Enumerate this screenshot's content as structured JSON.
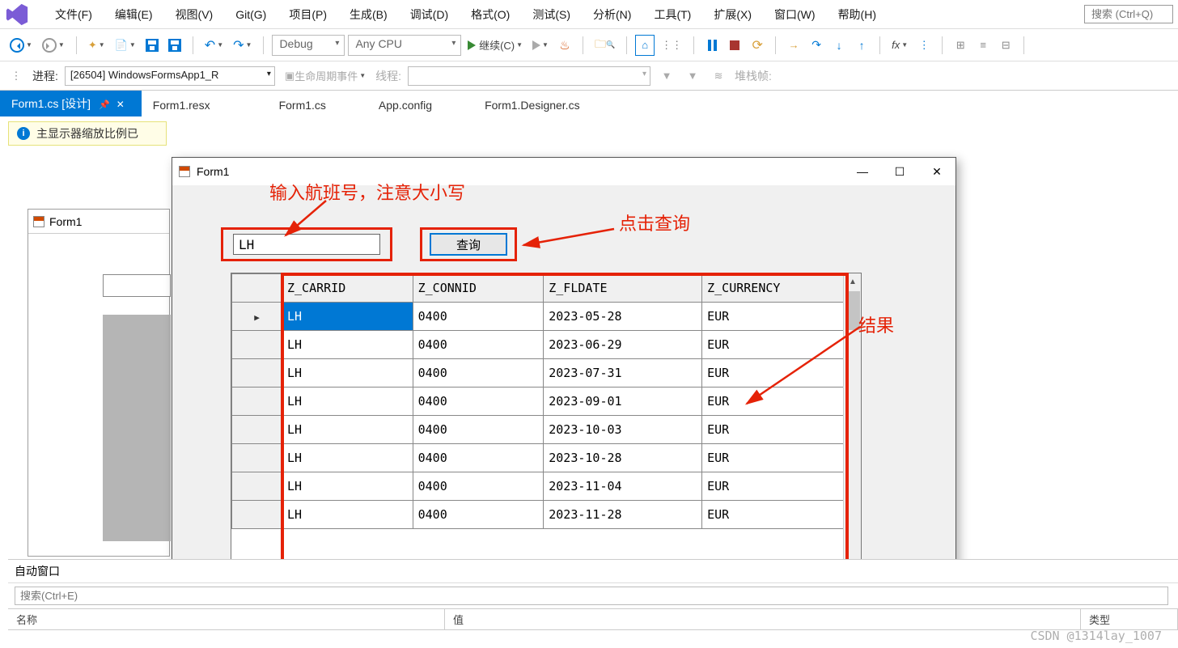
{
  "menu": {
    "items": [
      "文件(F)",
      "编辑(E)",
      "视图(V)",
      "Git(G)",
      "项目(P)",
      "生成(B)",
      "调试(D)",
      "格式(O)",
      "测试(S)",
      "分析(N)",
      "工具(T)",
      "扩展(X)",
      "窗口(W)",
      "帮助(H)"
    ],
    "search_placeholder": "搜索 (Ctrl+Q)"
  },
  "toolbar": {
    "config": "Debug",
    "platform": "Any CPU",
    "continue": "继续(C)"
  },
  "toolbar2": {
    "process_label": "进程:",
    "process_value": "[26504] WindowsFormsApp1_R",
    "lifecycle": "生命周期事件",
    "thread_label": "线程:",
    "stackframe": "堆栈帧:"
  },
  "tabs": [
    "Form1.cs [设计]",
    "Form1.resx",
    "Form1.cs",
    "App.config",
    "Form1.Designer.cs"
  ],
  "info_bar": "主显示器缩放比例已",
  "designer_form_title": "Form1",
  "running_form": {
    "title": "Form1",
    "input_value": "LH",
    "query_button": "查询",
    "columns": [
      "Z_CARRID",
      "Z_CONNID",
      "Z_FLDATE",
      "Z_CURRENCY"
    ],
    "rows": [
      {
        "carrid": "LH",
        "connid": "0400",
        "fldate": "2023-05-28",
        "currency": "EUR"
      },
      {
        "carrid": "LH",
        "connid": "0400",
        "fldate": "2023-06-29",
        "currency": "EUR"
      },
      {
        "carrid": "LH",
        "connid": "0400",
        "fldate": "2023-07-31",
        "currency": "EUR"
      },
      {
        "carrid": "LH",
        "connid": "0400",
        "fldate": "2023-09-01",
        "currency": "EUR"
      },
      {
        "carrid": "LH",
        "connid": "0400",
        "fldate": "2023-10-03",
        "currency": "EUR"
      },
      {
        "carrid": "LH",
        "connid": "0400",
        "fldate": "2023-10-28",
        "currency": "EUR"
      },
      {
        "carrid": "LH",
        "connid": "0400",
        "fldate": "2023-11-04",
        "currency": "EUR"
      },
      {
        "carrid": "LH",
        "connid": "0400",
        "fldate": "2023-11-28",
        "currency": "EUR"
      }
    ]
  },
  "annotations": {
    "input_hint": "输入航班号，注意大小写",
    "query_hint": "点击查询",
    "result_hint": "结果"
  },
  "autos": {
    "title": "自动窗口",
    "search_placeholder": "搜索(Ctrl+E)",
    "col_name": "名称",
    "col_value": "值",
    "col_type": "类型"
  },
  "watermark": "CSDN @1314lay_1007"
}
